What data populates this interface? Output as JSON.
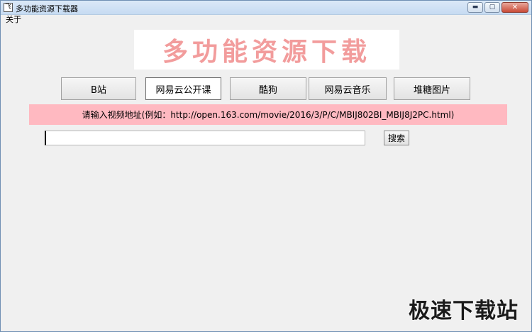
{
  "window": {
    "title": "多功能资源下载器",
    "app_icon_glyph": "飞",
    "minimize_glyph": "▬",
    "maximize_glyph": "▢",
    "close_glyph": "✕"
  },
  "menu": {
    "items": [
      {
        "label": "关于"
      }
    ]
  },
  "banner": {
    "text": "多功能资源下载"
  },
  "tabs": [
    {
      "label": "B站",
      "active": false
    },
    {
      "label": "网易云公开课",
      "active": true
    },
    {
      "label": "酷狗",
      "active": false
    },
    {
      "label": "网易云音乐",
      "active": false
    },
    {
      "label": "堆糖图片",
      "active": false
    }
  ],
  "hint": {
    "text": "请输入视频地址(例如：http://open.163.com/movie/2016/3/P/C/MBIJ802BI_MBIJ8J2PC.html)"
  },
  "search": {
    "value": "",
    "button_label": "搜索"
  },
  "watermark": {
    "text": "极速下载站"
  },
  "colors": {
    "banner_text": "#f29c9c",
    "hint_background": "#ffb9c1",
    "window_background": "#f0f0f0"
  }
}
